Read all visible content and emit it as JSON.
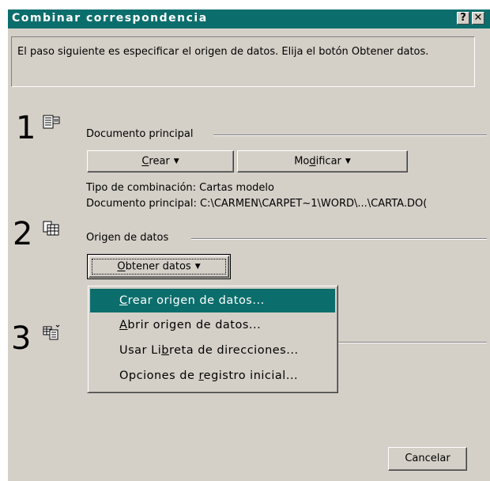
{
  "window": {
    "title": "Combinar correspondencia",
    "help_glyph": "?",
    "close_glyph": "✕"
  },
  "info_text": "El paso siguiente es especificar el origen de datos. Elija el botón Obtener datos.",
  "step1": {
    "number": "1",
    "group_label": "Documento principal",
    "create_button": {
      "pre": "",
      "accel": "C",
      "post": "rear",
      "arrow": "▼"
    },
    "modify_button": {
      "pre": "Mo",
      "accel": "d",
      "post": "ificar",
      "arrow": "▼"
    },
    "merge_type": "Tipo de combinación: Cartas modelo",
    "main_doc": "Documento principal: C:\\CARMEN\\CARPET~1\\WORD\\...\\CARTA.DO("
  },
  "step2": {
    "number": "2",
    "group_label": "Origen de datos",
    "get_data_button": {
      "pre": "",
      "accel": "O",
      "post": "btener datos",
      "arrow": "▼"
    }
  },
  "step3": {
    "number": "3"
  },
  "menu": {
    "items": [
      {
        "pre": "",
        "accel": "C",
        "post": "rear origen de datos...",
        "selected": true
      },
      {
        "pre": "",
        "accel": "A",
        "post": "brir origen de datos...",
        "selected": false
      },
      {
        "pre": "Usar Li",
        "accel": "b",
        "post": "reta de direcciones...",
        "selected": false
      },
      {
        "pre": "Opciones de ",
        "accel": "r",
        "post": "egistro inicial...",
        "selected": false
      }
    ]
  },
  "cancel_label": "Cancelar",
  "colors": {
    "titlebar": "#0c6e6c",
    "face": "#d4d0c8",
    "highlight": "#0c6e6c"
  }
}
